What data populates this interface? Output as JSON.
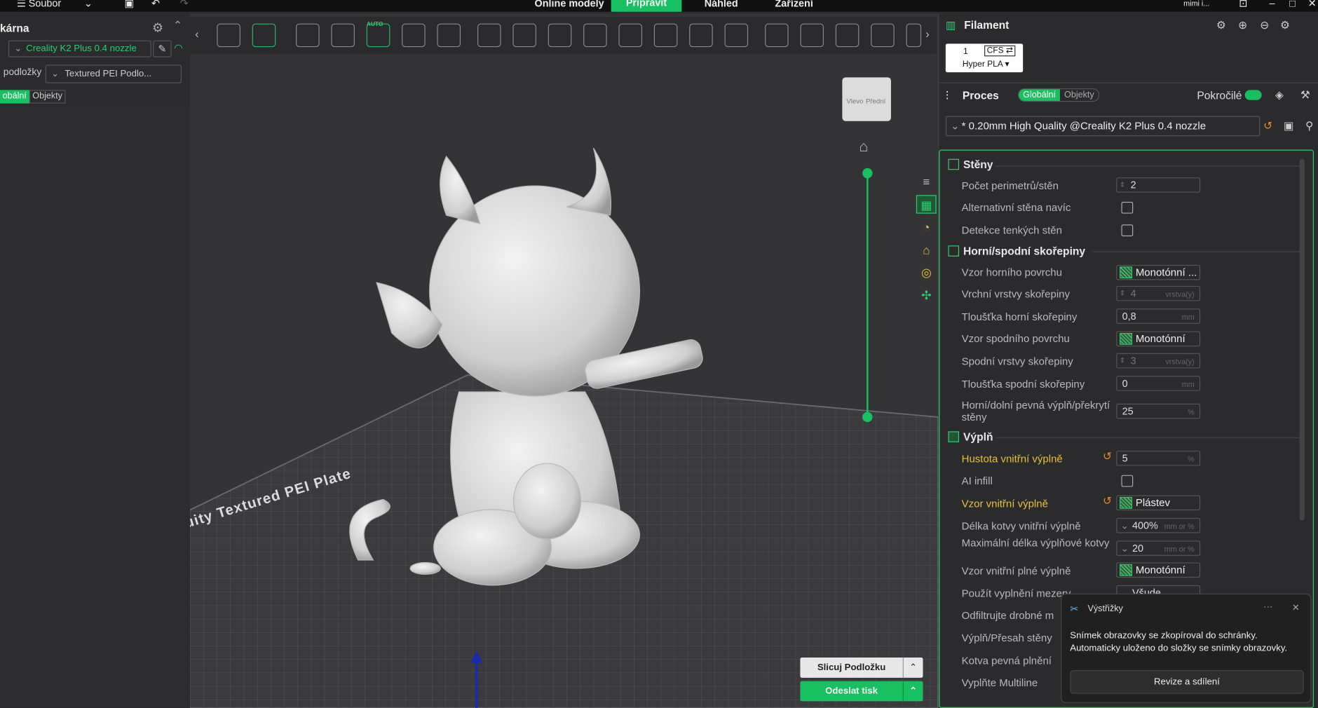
{
  "menu": {
    "file": "Soubor",
    "online_models": "Online modely",
    "prepare": "Připravit",
    "preview": "Náhled",
    "device": "Zařízení",
    "user": "mimi i..."
  },
  "printer": {
    "section_title": "kárna",
    "printer_name": "Creality K2 Plus 0.4 nozzle",
    "plate_label": "podložky",
    "plate_value": "Textured PEI Podlo...",
    "toggle_global": "obální",
    "toggle_objects": "Objekty"
  },
  "toolbar": {
    "auto_badge": "AUTO",
    "collapse_left": "‹",
    "collapse_right": "›"
  },
  "viewport": {
    "cube_left": "Vlevo",
    "cube_front": "Přední",
    "plate_text": "uity Textured PEI Plate"
  },
  "bottom_buttons": {
    "slice": "Slicuj Podložku",
    "send": "Odeslat tisk"
  },
  "filament": {
    "title": "Filament",
    "slot_number": "1",
    "cfs_label": "CFS ⇄",
    "filament_type": "Hyper PLA ▾"
  },
  "process": {
    "title": "Proces",
    "global": "Globální",
    "objects": "Objekty",
    "advanced": "Pokročilé",
    "preset": "* 0.20mm High Quality @Creality K2 Plus 0.4 nozzle"
  },
  "sections": {
    "walls": "Stěny",
    "top_bottom": "Horní/spodní skořepiny",
    "infill": "Výplň"
  },
  "settings": {
    "wall_loops": {
      "label": "Počet perimetrů/stěn",
      "value": "2"
    },
    "alt_wall": {
      "label": "Alternativní stěna navíc"
    },
    "thin_wall": {
      "label": "Detekce tenkých stěn"
    },
    "top_pattern": {
      "label": "Vzor horního povrchu",
      "value": "Monotónní ..."
    },
    "top_layers": {
      "label": "Vrchní vrstvy skořepiny",
      "value": "4",
      "unit": "vrstva(y)"
    },
    "top_thickness": {
      "label": "Tloušťka horní skořepiny",
      "value": "0,8",
      "unit": "mm"
    },
    "bottom_pattern": {
      "label": "Vzor spodního povrchu",
      "value": "Monotónní"
    },
    "bottom_layers": {
      "label": "Spodní vrstvy skořepiny",
      "value": "3",
      "unit": "vrstva(y)"
    },
    "bottom_thickness": {
      "label": "Tloušťka spodní skořepiny",
      "value": "0",
      "unit": "mm"
    },
    "solid_overlap": {
      "label": "Horní/dolní pevná výplň/překrytí stěny",
      "value": "25",
      "unit": "%"
    },
    "infill_density": {
      "label": "Hustota vnitřní výplně",
      "value": "5",
      "unit": "%"
    },
    "ai_infill": {
      "label": "AI infill"
    },
    "infill_pattern": {
      "label": "Vzor vnitřní výplně",
      "value": "Plástev"
    },
    "anchor_length": {
      "label": "Délka kotvy vnitřní výplně",
      "value": "400%",
      "unit": "mm or %"
    },
    "anchor_max": {
      "label": "Maximální délka výplňové kotvy",
      "value": "20",
      "unit": "mm or %"
    },
    "solid_pattern": {
      "label": "Vzor vnitřní plné výplně",
      "value": "Monotónní"
    },
    "gap_fill": {
      "label": "Použít vyplnění mezery",
      "value": "Všude"
    },
    "filter": {
      "label": "Odfiltrujte drobné m"
    },
    "overlap": {
      "label": "Výplň/Přesah stěny"
    },
    "solid_anchor": {
      "label": "Kotva pevná plnění"
    },
    "multiline": {
      "label": "Vyplňte Multiline"
    }
  },
  "toast": {
    "app": "Výstřižky",
    "more": "···",
    "close": "✕",
    "message": "Snímek obrazovky se zkopíroval do schránky. Automaticky uloženo do složky se snímky obrazovky.",
    "action": "Revize a sdílení"
  },
  "colors": {
    "accent": "#17c15f",
    "warning": "#e7c13a",
    "panel": "#2b2b2d",
    "viewport": "#343437"
  }
}
